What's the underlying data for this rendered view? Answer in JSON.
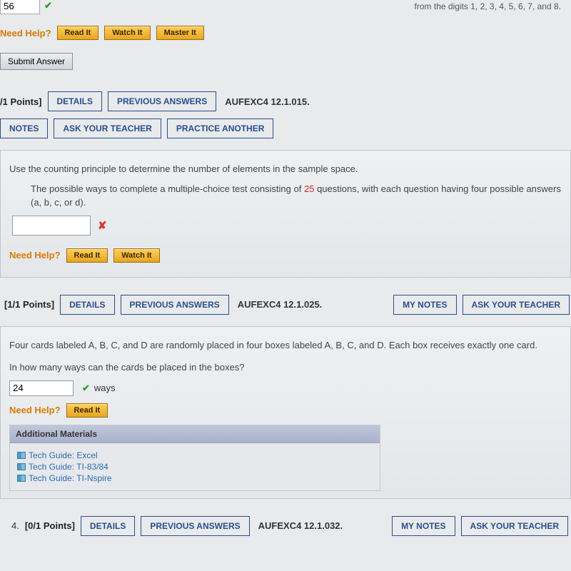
{
  "cutoff": {
    "partial_text": "from the digits 1, 2, 3, 4, 5, 6, 7, and 8.",
    "answer": "56"
  },
  "needHelp": {
    "label": "Need Help?",
    "read": "Read It",
    "watch": "Watch It",
    "master": "Master It"
  },
  "submit": "Submit Answer",
  "q2": {
    "points": "/1 Points]",
    "details": "DETAILS",
    "prev": "PREVIOUS ANSWERS",
    "code": "AUFEXC4 12.1.015.",
    "notes": "NOTES",
    "ask": "ASK YOUR TEACHER",
    "practice": "PRACTICE ANOTHER",
    "prompt1": "Use the counting principle to determine the number of elements in the sample space.",
    "prompt2a": "The possible ways to complete a multiple-choice test consisting of ",
    "prompt2_num": "25",
    "prompt2b": " questions, with each question having four possible answers (a, b, c, or d)."
  },
  "q3": {
    "points": "[1/1 Points]",
    "details": "DETAILS",
    "prev": "PREVIOUS ANSWERS",
    "code": "AUFEXC4 12.1.025.",
    "mynotes": "MY NOTES",
    "ask": "ASK YOUR TEACHER",
    "prompt1": "Four cards labeled A, B, C, and D are randomly placed in four boxes labeled A, B, C, and D. Each box receives exactly one card.",
    "prompt2": "In how many ways can the cards be placed in the boxes?",
    "answer": "24",
    "ways": "ways",
    "additional": "Additional Materials",
    "tech1": "Tech Guide: Excel",
    "tech2": "Tech Guide: TI-83/84",
    "tech3": "Tech Guide: TI-Nspire"
  },
  "q4": {
    "num": "4.",
    "points": "[0/1 Points]",
    "details": "DETAILS",
    "prev": "PREVIOUS ANSWERS",
    "code": "AUFEXC4 12.1.032.",
    "mynotes": "MY NOTES",
    "ask": "ASK YOUR TEACHER"
  }
}
